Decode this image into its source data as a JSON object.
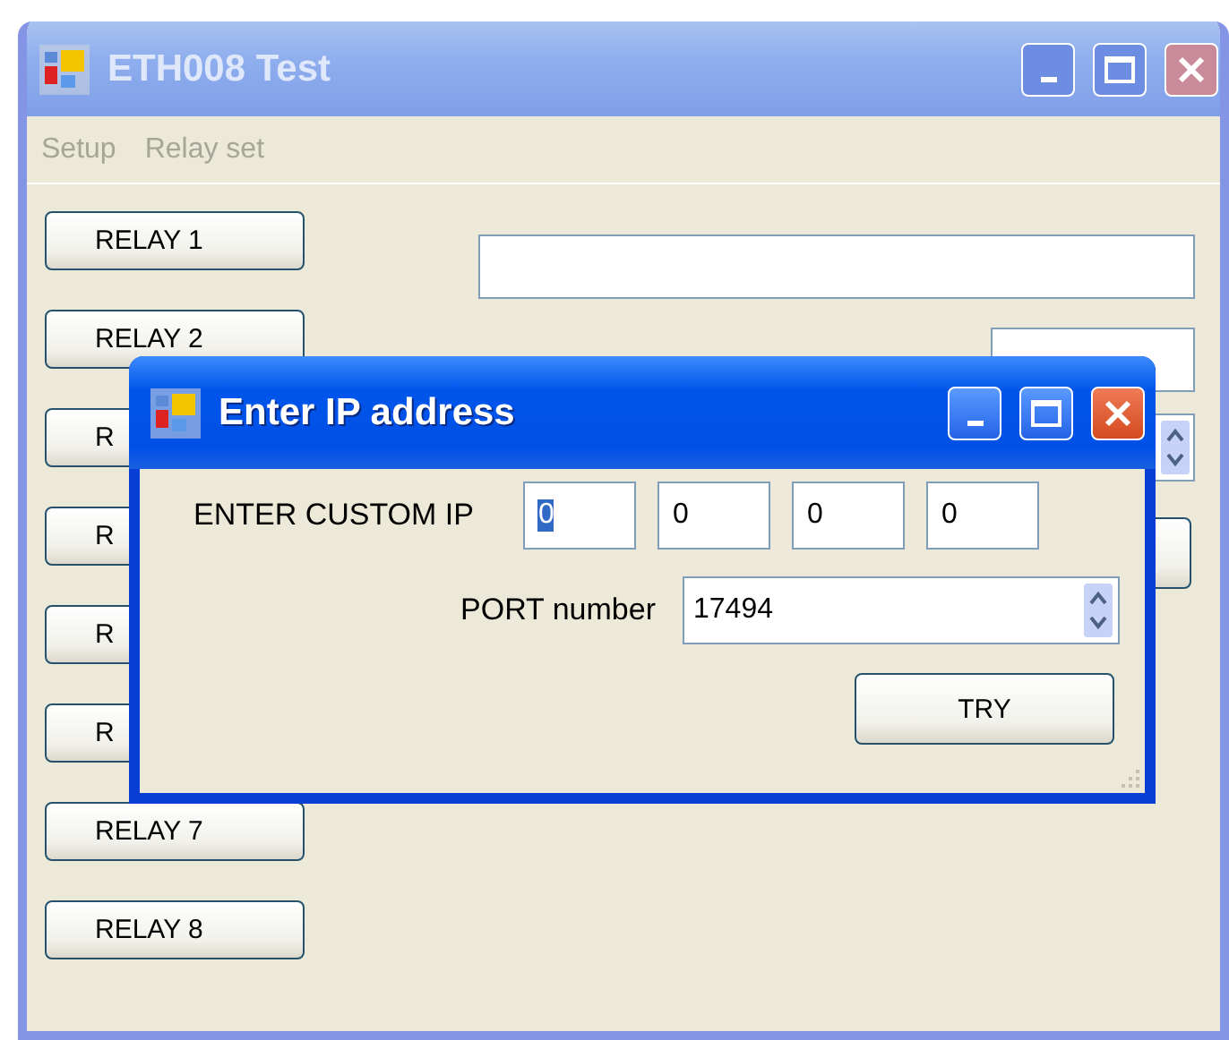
{
  "main_window": {
    "title": "ETH008 Test",
    "active": false,
    "menu": [
      "Setup",
      "Relay set"
    ],
    "relay_buttons": [
      "RELAY 1",
      "RELAY 2",
      "R",
      "R",
      "R",
      "R",
      "RELAY 7",
      "RELAY 8"
    ]
  },
  "dialog": {
    "title": "Enter IP address",
    "active": true,
    "ip_label": "ENTER CUSTOM IP",
    "ip_fields": [
      {
        "value": "0",
        "selected": true
      },
      {
        "value": "0",
        "selected": false
      },
      {
        "value": "0",
        "selected": false
      },
      {
        "value": "0",
        "selected": false
      }
    ],
    "port_label": "PORT number",
    "port_value": "17494",
    "button": "TRY"
  }
}
